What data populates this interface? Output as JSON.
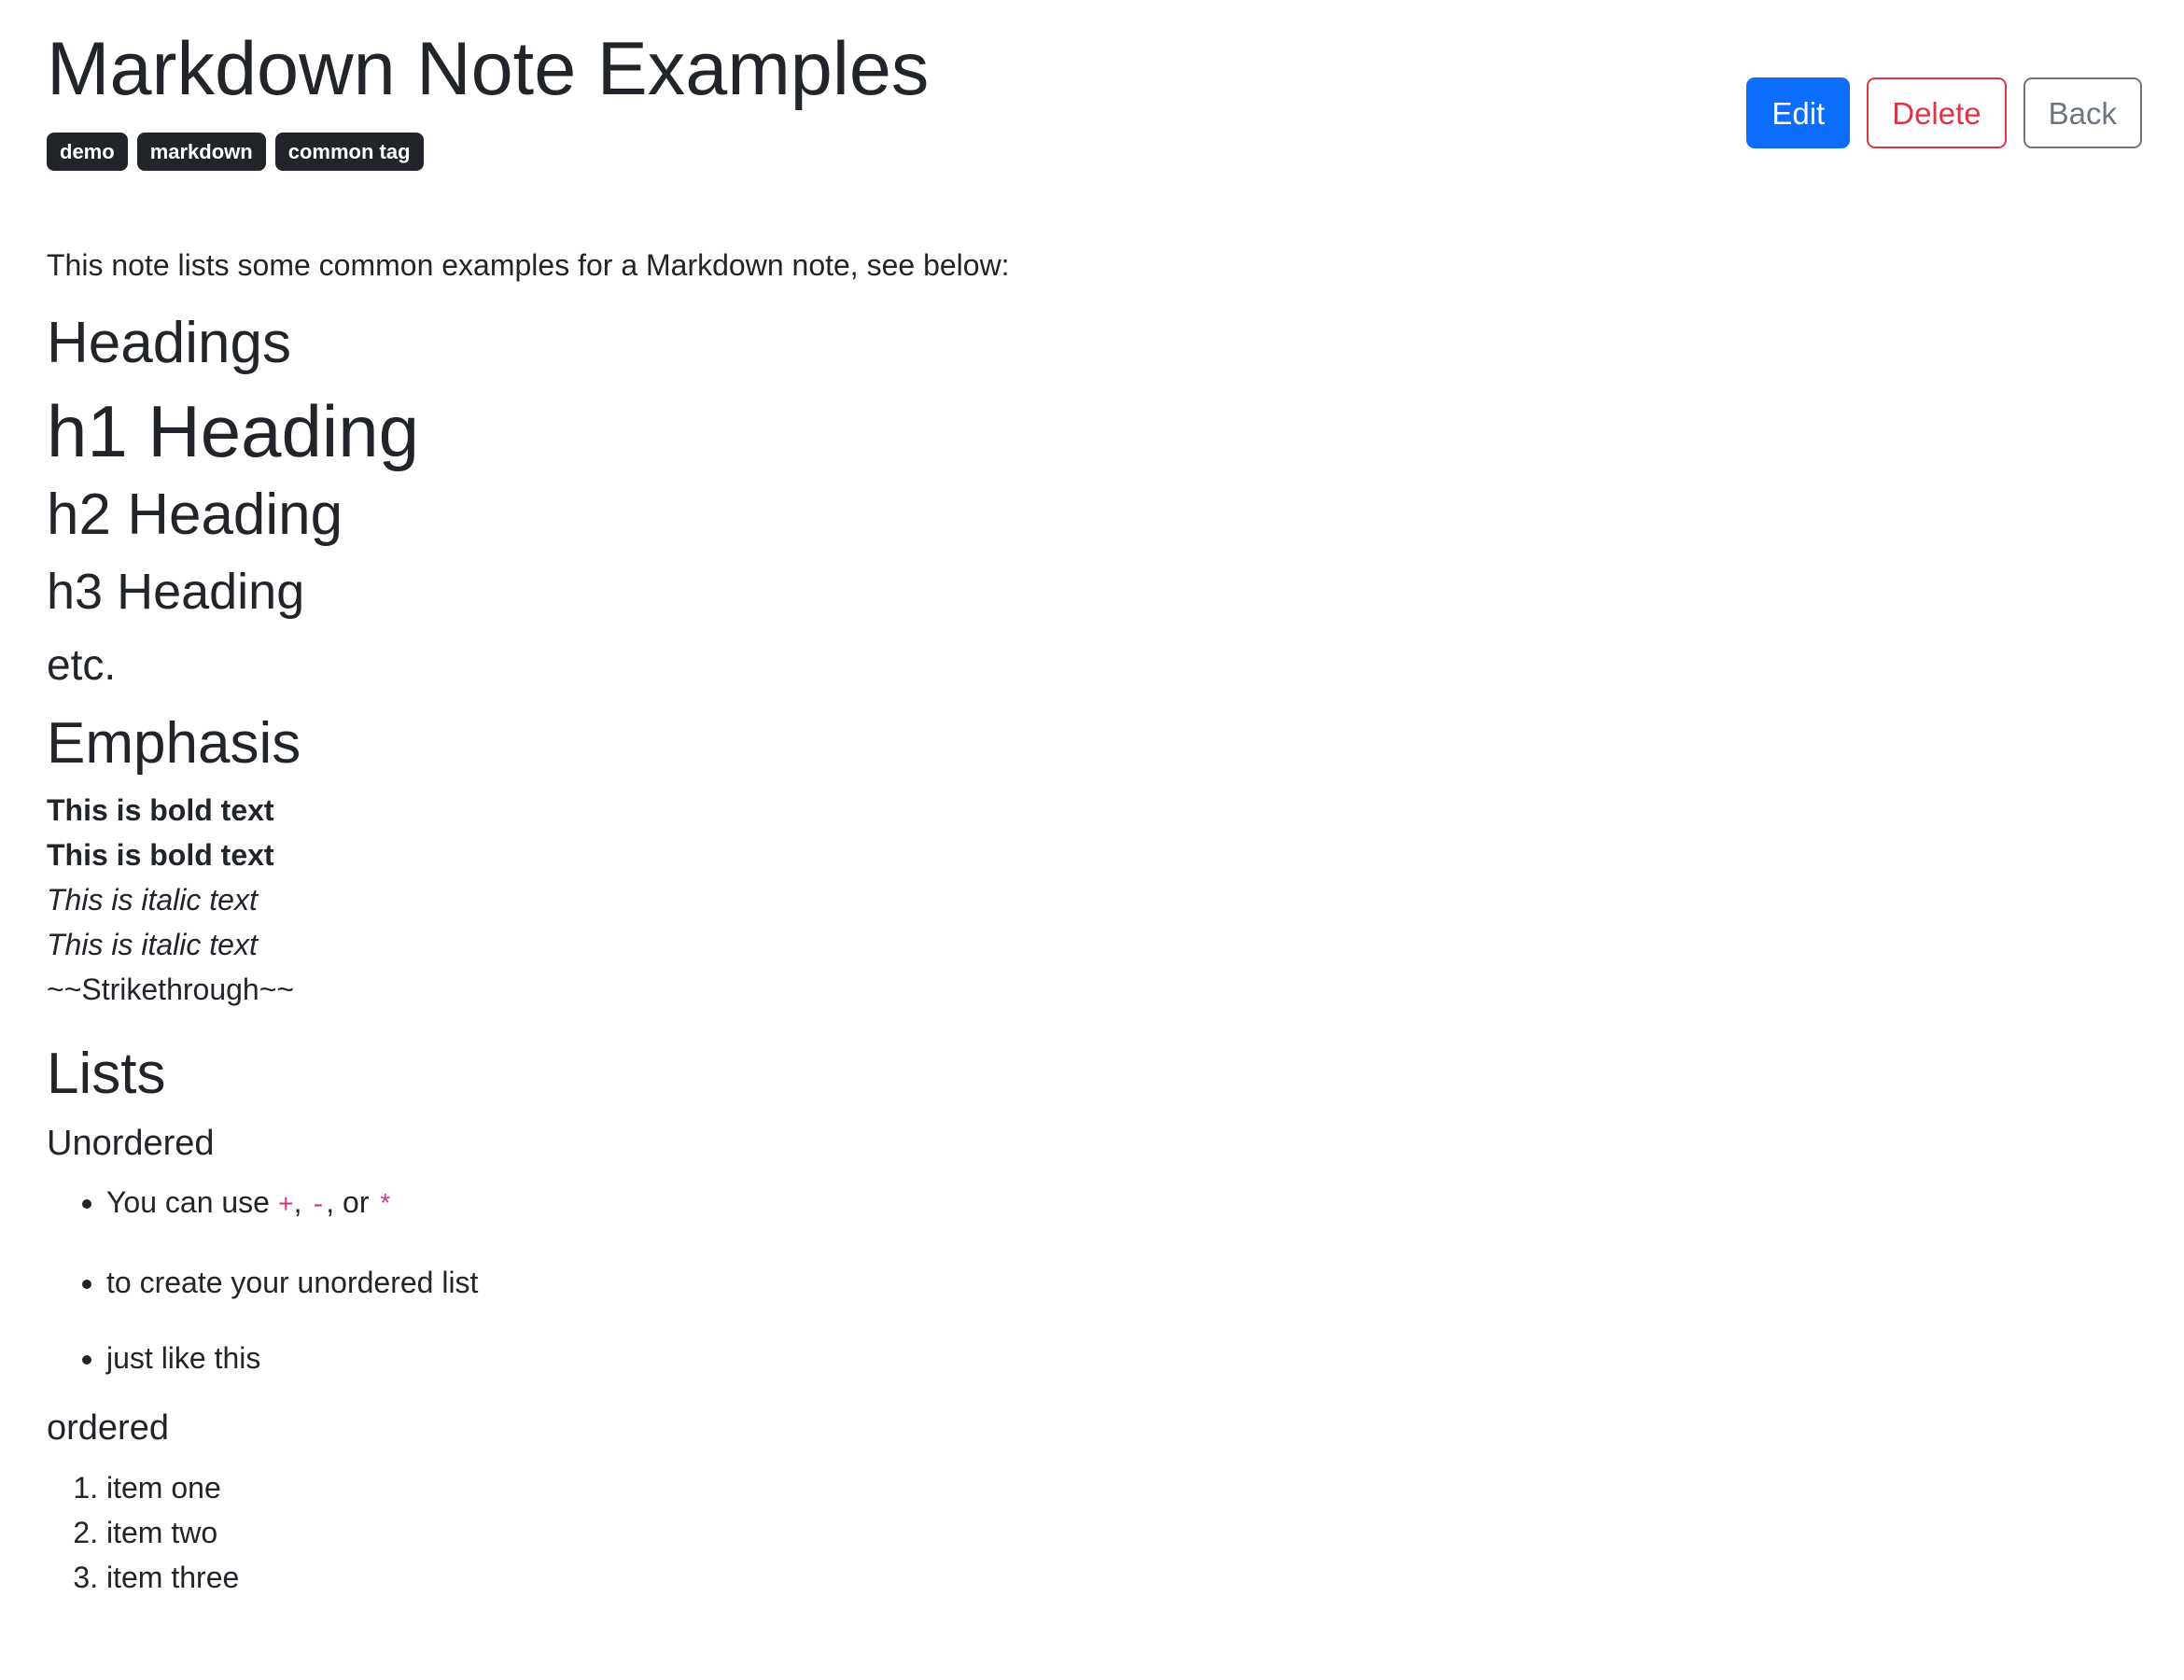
{
  "note": {
    "title": "Markdown Note Examples",
    "tags": [
      "demo",
      "markdown",
      "common tag"
    ]
  },
  "actions": {
    "edit_label": "Edit",
    "delete_label": "Delete",
    "back_label": "Back"
  },
  "colors": {
    "primary": "#0d6efd",
    "danger": "#dc3545",
    "secondary": "#6c757d",
    "tag_bg": "#212529",
    "code": "#d63384"
  },
  "content": {
    "intro": "This note lists some common examples for a Markdown note, see below:",
    "headings_section": "Headings",
    "h1_example": "h1 Heading",
    "h2_example": "h2 Heading",
    "h3_example": "h3 Heading",
    "etc": "etc.",
    "emphasis_section": "Emphasis",
    "bold_1": "This is bold text",
    "bold_2": "This is bold text",
    "italic_1": "This is italic text",
    "italic_2": "This is italic text",
    "strikethrough": "~~Strikethrough~~",
    "lists_section": "Lists",
    "unordered_heading": "Unordered",
    "unordered": {
      "item1_text_a": "You can use ",
      "code_plus": "+",
      "sep1": ", ",
      "code_minus": "-",
      "sep2": ", or ",
      "code_star": "*",
      "item2": "to create your unordered list",
      "item3": "just like this"
    },
    "ordered_heading": "ordered",
    "ordered_items": [
      "item one",
      "item two",
      "item three"
    ]
  }
}
